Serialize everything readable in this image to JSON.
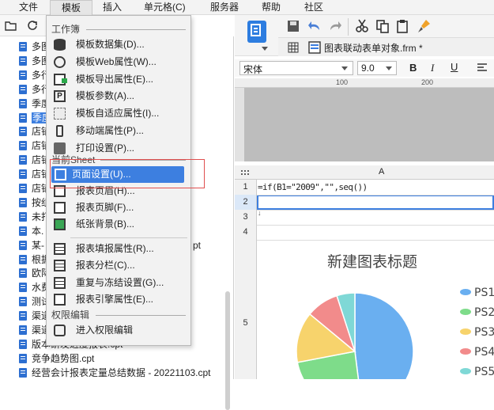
{
  "menubar": {
    "items": [
      "文件",
      "模板",
      "插入",
      "单元格(C)",
      "服务器",
      "帮助",
      "社区"
    ]
  },
  "tree": {
    "items": [
      {
        "label": "多图"
      },
      {
        "label": "多图"
      },
      {
        "label": "多行"
      },
      {
        "label": "多行"
      },
      {
        "label": "季度"
      },
      {
        "label": "季度",
        "selected": true
      },
      {
        "label": "店铺"
      },
      {
        "label": "店铺"
      },
      {
        "label": "店铺"
      },
      {
        "label": "店铺"
      },
      {
        "label": "店铺"
      },
      {
        "label": "按组"
      },
      {
        "label": "未打"
      },
      {
        "label": "本."
      },
      {
        "label": "某-",
        "suffix": "pt"
      },
      {
        "label": "根据"
      },
      {
        "label": "欧际"
      },
      {
        "label": "水费"
      },
      {
        "label": "测试"
      },
      {
        "label": "渠道"
      },
      {
        "label": "渠道"
      },
      {
        "label": "版本研发进度报表.cpt"
      },
      {
        "label": "竞争趋势图.cpt"
      },
      {
        "label": "经营会计报表定量总结数据 - 20221103.cpt"
      }
    ]
  },
  "dropdown": {
    "section_workbook": "工作簿",
    "section_sheet": "当前Sheet",
    "section_permission": "权限编辑",
    "workbook_items": [
      {
        "label": "模板数据集(D)...",
        "icon": "database-icon"
      },
      {
        "label": "模板Web属性(W)...",
        "icon": "globe-icon"
      },
      {
        "label": "模板导出属性(E)...",
        "icon": "export-icon"
      },
      {
        "label": "模板参数(A)...",
        "icon": "parameter-icon"
      },
      {
        "label": "模板自适应属性(I)...",
        "icon": "adaptive-icon"
      },
      {
        "label": "移动端属性(P)...",
        "icon": "mobile-icon"
      },
      {
        "label": "打印设置(P)...",
        "icon": "printer-icon"
      }
    ],
    "sheet_items": [
      {
        "label": "页面设置(U)...",
        "icon": "page-setup-icon",
        "highlighted": true
      },
      {
        "label": "报表页眉(H)...",
        "icon": "header-icon"
      },
      {
        "label": "报表页脚(F)...",
        "icon": "footer-icon"
      },
      {
        "label": "纸张背景(B)...",
        "icon": "background-image-icon"
      }
    ],
    "sheet_items2": [
      {
        "label": "报表填报属性(R)...",
        "icon": "fill-attr-icon"
      },
      {
        "label": "报表分栏(C)...",
        "icon": "columns-icon"
      },
      {
        "label": "重复与冻结设置(G)...",
        "icon": "freeze-icon"
      },
      {
        "label": "报表引擎属性(E)...",
        "icon": "engine-icon"
      }
    ],
    "permission_items": [
      {
        "label": "进入权限编辑",
        "icon": "lock-icon"
      }
    ]
  },
  "editor": {
    "tab_title": "图表联动表单对象.frm *",
    "font_name": "宋体",
    "font_size": "9.0",
    "ruler_labels": [
      "100",
      "200"
    ],
    "column_header": "A",
    "row_numbers": [
      "1",
      "2",
      "3",
      "4",
      "5"
    ],
    "formula": "=if(B1=\"2009\",\"\",seq())"
  },
  "chart_data": {
    "type": "pie",
    "title": "新建图表标题",
    "categories": [
      "PS1",
      "PS2",
      "PS3",
      "PS4",
      "PS5"
    ],
    "values": [
      48,
      24,
      14,
      9,
      5
    ],
    "colors": [
      "#6aaff0",
      "#7edc8a",
      "#f7d36c",
      "#f28b8b",
      "#7fd8d6"
    ],
    "legend_position": "right"
  }
}
